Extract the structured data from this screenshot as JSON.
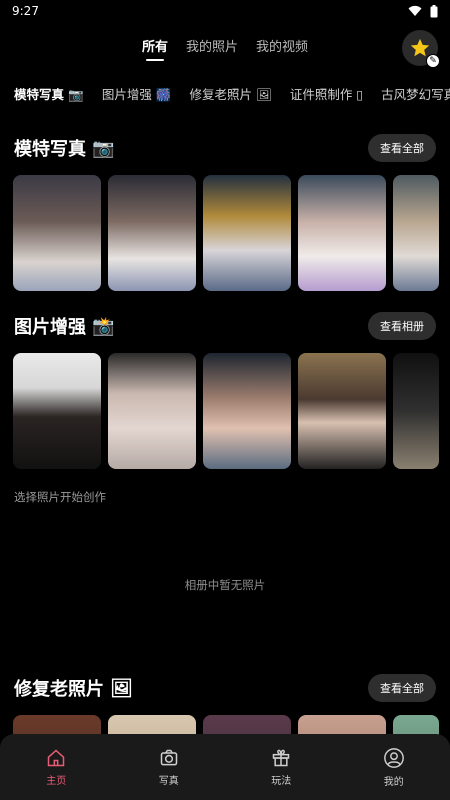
{
  "status": {
    "time": "9:27"
  },
  "top_tabs": [
    {
      "label": "所有",
      "active": true
    },
    {
      "label": "我的照片",
      "active": false
    },
    {
      "label": "我的视频",
      "active": false
    }
  ],
  "category_tabs": [
    {
      "label": "模特写真 📷",
      "active": true
    },
    {
      "label": "图片增强 🎆",
      "active": false
    },
    {
      "label": "修复老照片 🖼",
      "active": false
    },
    {
      "label": "证件照制作 ▯",
      "active": false
    },
    {
      "label": "古风梦幻写真",
      "active": false
    }
  ],
  "sections": {
    "model": {
      "title": "模特写真",
      "emoji": "📷",
      "button": "查看全部"
    },
    "enhance": {
      "title": "图片增强",
      "emoji": "📸",
      "button": "查看相册"
    },
    "restore": {
      "title": "修复老照片",
      "emoji": "🖼",
      "button": "查看全部"
    }
  },
  "hint": "选择照片开始创作",
  "empty": "相册中暂无照片",
  "bottom_nav": [
    {
      "label": "主页",
      "icon": "home-icon",
      "active": true
    },
    {
      "label": "写真",
      "icon": "camera-icon",
      "active": false
    },
    {
      "label": "玩法",
      "icon": "gift-icon",
      "active": false
    },
    {
      "label": "我的",
      "icon": "user-icon",
      "active": false
    }
  ],
  "colors": {
    "accent": "#e85d75",
    "background": "#000000",
    "button_bg": "#2e2e2e"
  }
}
